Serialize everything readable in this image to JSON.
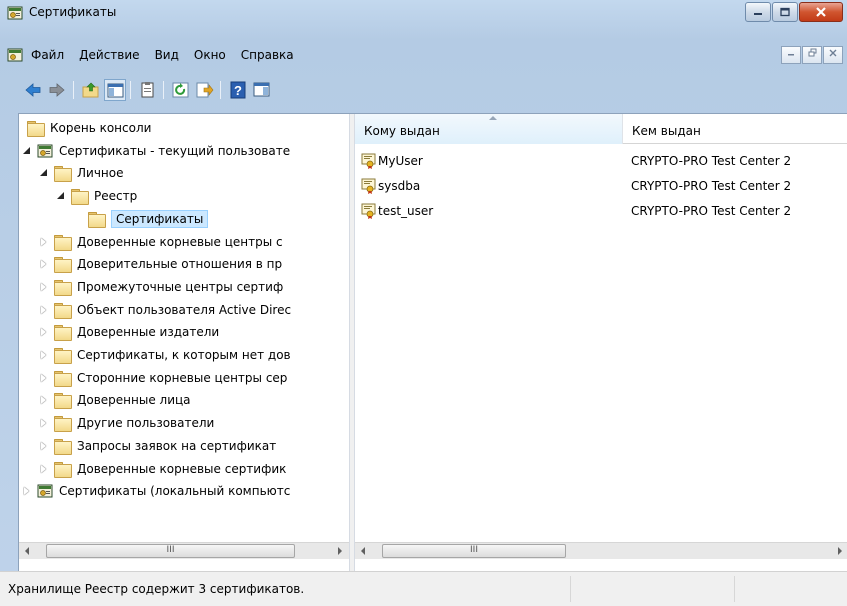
{
  "window": {
    "title": "Сертификаты"
  },
  "menubar": {
    "items": [
      {
        "label": "Файл"
      },
      {
        "label": "Действие"
      },
      {
        "label": "Вид"
      },
      {
        "label": "Окно"
      },
      {
        "label": "Справка"
      }
    ]
  },
  "toolbar": {
    "buttons": [
      "back-arrow-icon",
      "forward-arrow-icon",
      "up-folder-icon",
      "show-hide-tree-icon",
      "clipboard-icon",
      "refresh-icon",
      "export-list-icon",
      "help-icon",
      "action-pane-icon"
    ]
  },
  "tree": {
    "items": [
      {
        "label": "Корень консоли",
        "level": 0,
        "expander": "none",
        "icon": "folder-icon"
      },
      {
        "label": "Сертификаты - текущий пользовате",
        "level": 1,
        "expander": "open",
        "icon": "certificate-store-icon"
      },
      {
        "label": "Личное",
        "level": 2,
        "expander": "open",
        "icon": "folder-icon"
      },
      {
        "label": "Реестр",
        "level": 3,
        "expander": "open",
        "icon": "folder-icon"
      },
      {
        "label": "Сертификаты",
        "level": 4,
        "expander": "none",
        "icon": "folder-icon",
        "selected": true
      },
      {
        "label": "Доверенные корневые центры с",
        "level": 2,
        "expander": "closed",
        "icon": "folder-icon"
      },
      {
        "label": "Доверительные отношения в пр",
        "level": 2,
        "expander": "closed",
        "icon": "folder-icon"
      },
      {
        "label": "Промежуточные центры сертиф",
        "level": 2,
        "expander": "closed",
        "icon": "folder-icon"
      },
      {
        "label": "Объект пользователя Active Direc",
        "level": 2,
        "expander": "closed",
        "icon": "folder-icon"
      },
      {
        "label": "Доверенные издатели",
        "level": 2,
        "expander": "closed",
        "icon": "folder-icon"
      },
      {
        "label": "Сертификаты, к которым нет дов",
        "level": 2,
        "expander": "closed",
        "icon": "folder-icon"
      },
      {
        "label": "Сторонние корневые центры сер",
        "level": 2,
        "expander": "closed",
        "icon": "folder-icon"
      },
      {
        "label": "Доверенные лица",
        "level": 2,
        "expander": "closed",
        "icon": "folder-icon"
      },
      {
        "label": "Другие пользователи",
        "level": 2,
        "expander": "closed",
        "icon": "folder-icon"
      },
      {
        "label": "Запросы заявок на сертификат",
        "level": 2,
        "expander": "closed",
        "icon": "folder-icon"
      },
      {
        "label": "Доверенные корневые сертифик",
        "level": 2,
        "expander": "closed",
        "icon": "folder-icon"
      },
      {
        "label": "Сертификаты (локальный компьютс",
        "level": 1,
        "expander": "closed",
        "icon": "certificate-store-icon"
      }
    ],
    "scroll_thumb": "III"
  },
  "list": {
    "columns": [
      {
        "label": "Кому выдан",
        "sorted": true
      },
      {
        "label": "Кем выдан",
        "sorted": false
      }
    ],
    "rows": [
      {
        "issued_to": "MyUser",
        "issued_by": "CRYPTO-PRO Test Center 2"
      },
      {
        "issued_to": "sysdba",
        "issued_by": "CRYPTO-PRO Test Center 2"
      },
      {
        "issued_to": "test_user",
        "issued_by": "CRYPTO-PRO Test Center 2"
      }
    ],
    "scroll_thumb": "III"
  },
  "statusbar": {
    "text": "Хранилище Реестр содержит 3 сертификатов."
  }
}
